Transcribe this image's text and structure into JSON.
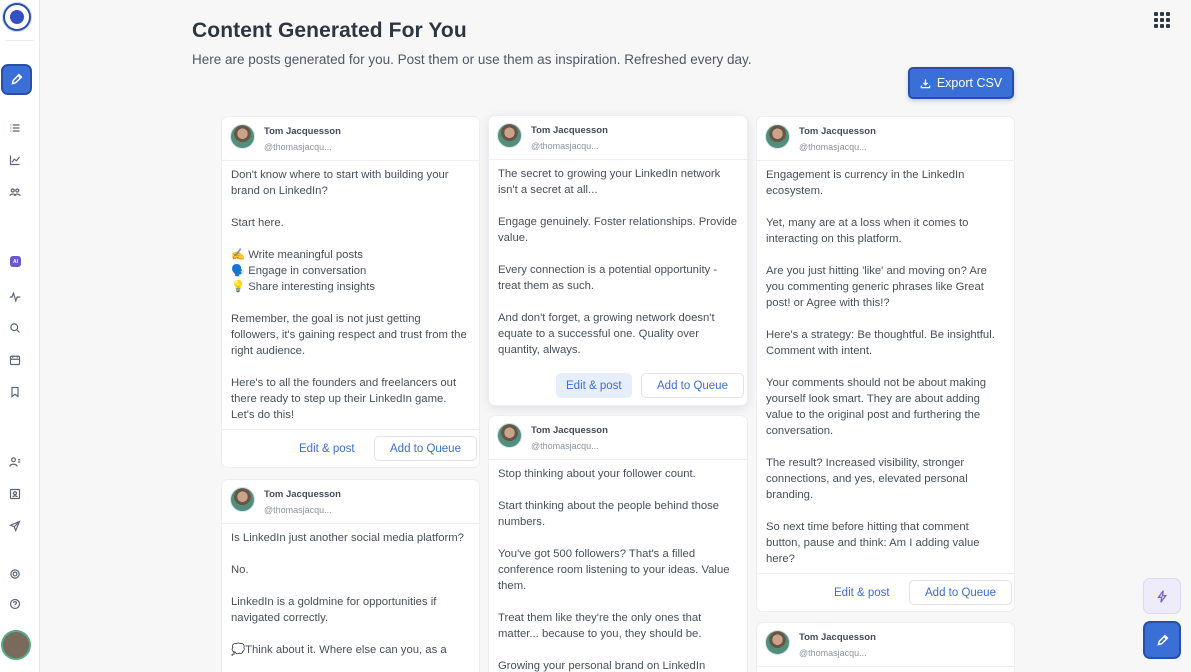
{
  "header": {
    "title": "Content Generated For You",
    "subtitle": "Here are posts generated for you. Post them or use them as inspiration. Refreshed every day.",
    "export_label": "Export CSV"
  },
  "colors": {
    "accent": "#3b6fd8",
    "accent_dark": "#274fa8",
    "text": "#48505c"
  },
  "sidebar": {
    "icons": [
      "logo",
      "pencil-icon",
      "list-icon",
      "chart-icon",
      "users-icon",
      "ai-icon",
      "activity-icon",
      "search-icon",
      "calendar-icon",
      "bookmark-icon",
      "user-list-icon",
      "contact-card-icon",
      "send-icon",
      "settings-icon",
      "help-icon",
      "user-avatar"
    ],
    "ai_badge": "AI"
  },
  "actions": {
    "edit": "Edit & post",
    "queue": "Add to Queue"
  },
  "posts": [
    {
      "author": "Tom Jacquesson",
      "handle": "@thomasjacqu...",
      "paragraphs": [
        "Don't know where to start with building your brand on LinkedIn?",
        "Start here.",
        "✍️ Write meaningful posts\n🗣️ Engage in conversation\n💡 Share interesting insights",
        "Remember, the goal is not just getting followers, it's gaining respect and trust from the right audience.",
        "Here's to all the founders and freelancers out there ready to step up their LinkedIn game. Let's do this!"
      ]
    },
    {
      "author": "Tom Jacquesson",
      "handle": "@thomasjacqu...",
      "paragraphs": [
        "Is LinkedIn just another social media platform?",
        "No.",
        "LinkedIn is a goldmine for opportunities if navigated correctly.",
        "💭Think about it. Where else can you, as a"
      ]
    },
    {
      "author": "Tom Jacquesson",
      "handle": "@thomasjacqu...",
      "paragraphs": [
        "The secret to growing your LinkedIn network isn't a secret at all...",
        "Engage genuinely. Foster relationships. Provide value.",
        "Every connection is a potential opportunity - treat them as such.",
        "And don't forget, a growing network doesn't equate to a successful one. Quality over quantity, always."
      ]
    },
    {
      "author": "Tom Jacquesson",
      "handle": "@thomasjacqu...",
      "paragraphs": [
        "Stop thinking about your follower count.",
        "Start thinking about the people behind those numbers.",
        "You've got 500 followers? That's a filled conference room listening to your ideas. Value them.",
        "Treat them like they're the only ones that matter... because to you, they should be.",
        "Growing your personal brand on LinkedIn"
      ]
    },
    {
      "author": "Tom Jacquesson",
      "handle": "@thomasjacqu...",
      "paragraphs": [
        "Engagement is currency in the LinkedIn ecosystem.",
        "Yet, many are at a loss when it comes to interacting on this platform.",
        "Are you just hitting 'like' and moving on? Are you commenting generic phrases like Great post! or Agree with this!?",
        "Here's a strategy: Be thoughtful. Be insightful. Comment with intent.",
        "Your comments should not be about making yourself look smart. They are about adding value to the original post and furthering the conversation.",
        "The result? Increased visibility, stronger connections, and yes, elevated personal branding.",
        "So next time before hitting that comment button, pause and think: Am I adding value here?"
      ]
    },
    {
      "author": "Tom Jacquesson",
      "handle": "@thomasjacqu...",
      "paragraphs": []
    }
  ]
}
